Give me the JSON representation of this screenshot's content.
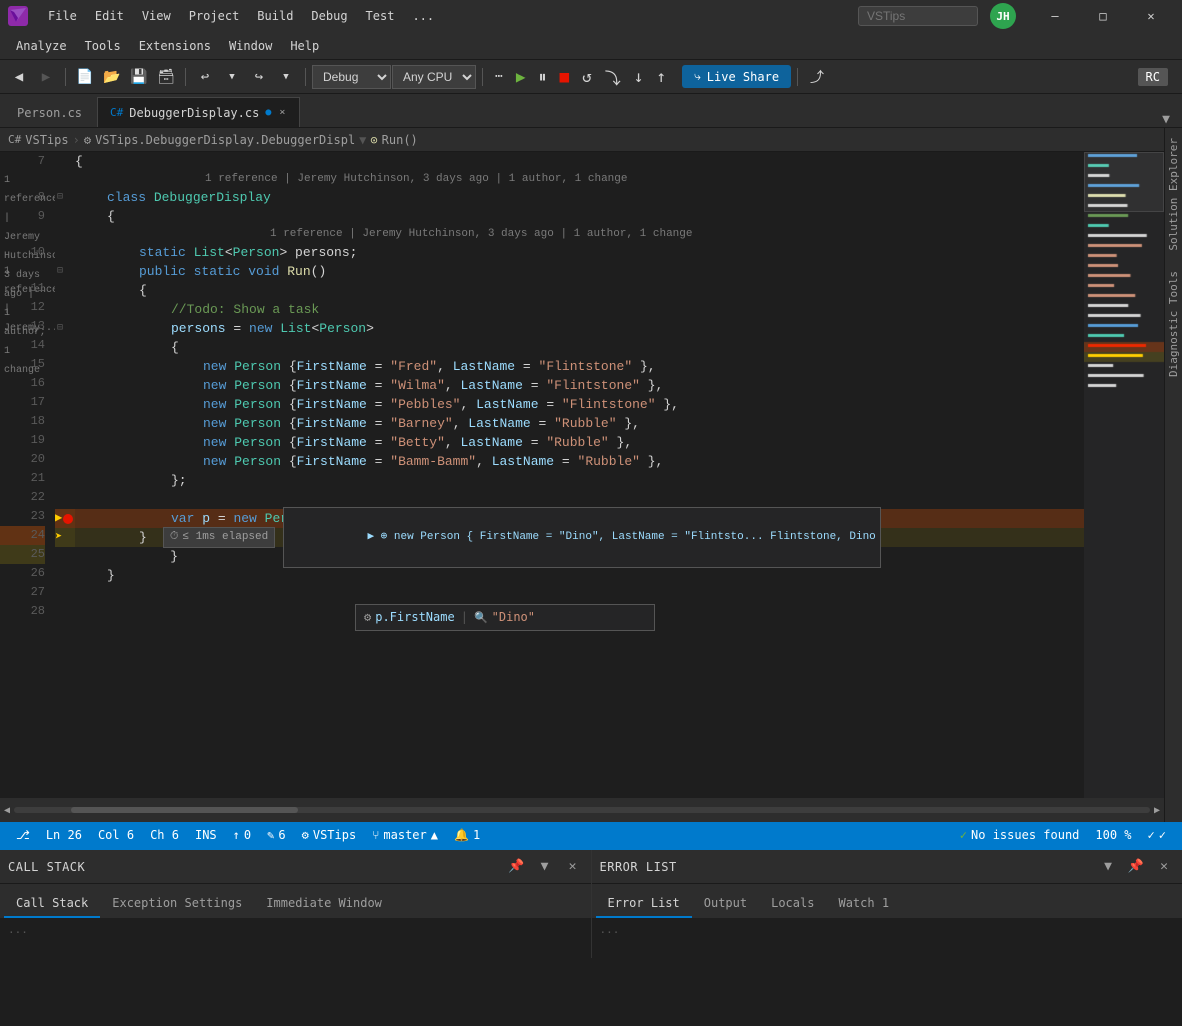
{
  "titleBar": {
    "logoText": "VS",
    "menus": [
      "File",
      "Edit",
      "View",
      "Project",
      "Build",
      "Debug",
      "Test",
      "..."
    ],
    "searchPlaceholder": "VSTips",
    "userInitials": "JH",
    "controls": [
      "—",
      "□",
      "✕"
    ]
  },
  "menuBar": {
    "items": [
      "Analyze",
      "Tools",
      "Extensions",
      "Window",
      "Help"
    ]
  },
  "toolbar": {
    "debugMode": "Debug",
    "platform": "Any CPU",
    "liveShareLabel": "Live Share",
    "rcLabel": "RC"
  },
  "tabs": {
    "inactive": "Person.cs",
    "active": "DebuggerDisplay.cs",
    "closeLabel": "×",
    "modifiedIcon": "●"
  },
  "breadcrumb": {
    "project": "VSTips",
    "class": "VSTips.DebuggerDisplay.DebuggerDispl",
    "method": "Run()"
  },
  "codeLines": [
    {
      "num": "7",
      "indent": 0,
      "tokens": [
        {
          "t": "{",
          "c": "plain"
        }
      ]
    },
    {
      "num": "8",
      "indent": 1,
      "tokens": [
        {
          "t": "class ",
          "c": "kw"
        },
        {
          "t": "DebuggerDisplay",
          "c": "class-name"
        }
      ],
      "codelens": "1 reference | Jeremy Hutchinson, 3 days ago | 1 author, 1 change"
    },
    {
      "num": "9",
      "indent": 1,
      "tokens": [
        {
          "t": "{",
          "c": "plain"
        }
      ]
    },
    {
      "num": "10",
      "indent": 2,
      "tokens": [
        {
          "t": "static ",
          "c": "kw"
        },
        {
          "t": "List",
          "c": "type"
        },
        {
          "t": "<",
          "c": "plain"
        },
        {
          "t": "Person",
          "c": "type"
        },
        {
          "t": "> persons;",
          "c": "plain"
        }
      ],
      "codelens": "1 reference | Jeremy Hutchinson, 3 days ago | 1 author, 1 change"
    },
    {
      "num": "11",
      "indent": 2,
      "tokens": [
        {
          "t": "public ",
          "c": "kw"
        },
        {
          "t": "static ",
          "c": "kw"
        },
        {
          "t": "void ",
          "c": "kw"
        },
        {
          "t": "Run",
          "c": "method"
        },
        {
          "t": "()",
          "c": "plain"
        }
      ]
    },
    {
      "num": "12",
      "indent": 2,
      "tokens": [
        {
          "t": "{",
          "c": "plain"
        }
      ]
    },
    {
      "num": "13",
      "indent": 3,
      "tokens": [
        {
          "t": "//Todo: Show a task",
          "c": "comment"
        }
      ]
    },
    {
      "num": "14",
      "indent": 3,
      "tokens": [
        {
          "t": "persons",
          "c": "prop"
        },
        {
          "t": " = ",
          "c": "plain"
        },
        {
          "t": "new ",
          "c": "kw"
        },
        {
          "t": "List",
          "c": "type"
        },
        {
          "t": "<",
          "c": "plain"
        },
        {
          "t": "Person",
          "c": "type"
        },
        {
          "t": ">",
          "c": "plain"
        }
      ]
    },
    {
      "num": "15",
      "indent": 3,
      "tokens": [
        {
          "t": "{",
          "c": "plain"
        }
      ]
    },
    {
      "num": "16",
      "indent": 4,
      "tokens": [
        {
          "t": "new ",
          "c": "kw"
        },
        {
          "t": "Person",
          "c": "type"
        },
        {
          "t": " {",
          "c": "plain"
        },
        {
          "t": "FirstName",
          "c": "prop"
        },
        {
          "t": " = ",
          "c": "plain"
        },
        {
          "t": "\"Fred\"",
          "c": "str"
        },
        {
          "t": ", ",
          "c": "plain"
        },
        {
          "t": "LastName",
          "c": "prop"
        },
        {
          "t": " = ",
          "c": "plain"
        },
        {
          "t": "\"Flintstone\"",
          "c": "str"
        },
        {
          "t": " },",
          "c": "plain"
        }
      ]
    },
    {
      "num": "17",
      "indent": 4,
      "tokens": [
        {
          "t": "new ",
          "c": "kw"
        },
        {
          "t": "Person",
          "c": "type"
        },
        {
          "t": " {",
          "c": "plain"
        },
        {
          "t": "FirstName",
          "c": "prop"
        },
        {
          "t": " = ",
          "c": "plain"
        },
        {
          "t": "\"Wilma\"",
          "c": "str"
        },
        {
          "t": ", ",
          "c": "plain"
        },
        {
          "t": "LastName",
          "c": "prop"
        },
        {
          "t": " = ",
          "c": "plain"
        },
        {
          "t": "\"Flintstone\"",
          "c": "str"
        },
        {
          "t": " },",
          "c": "plain"
        }
      ]
    },
    {
      "num": "18",
      "indent": 4,
      "tokens": [
        {
          "t": "new ",
          "c": "kw"
        },
        {
          "t": "Person",
          "c": "type"
        },
        {
          "t": " {",
          "c": "plain"
        },
        {
          "t": "FirstName",
          "c": "prop"
        },
        {
          "t": " = ",
          "c": "plain"
        },
        {
          "t": "\"Pebbles\"",
          "c": "str"
        },
        {
          "t": ", ",
          "c": "plain"
        },
        {
          "t": "LastName",
          "c": "prop"
        },
        {
          "t": " = ",
          "c": "plain"
        },
        {
          "t": "\"Flintstone\"",
          "c": "str"
        },
        {
          "t": " },",
          "c": "plain"
        }
      ]
    },
    {
      "num": "19",
      "indent": 4,
      "tokens": [
        {
          "t": "new ",
          "c": "kw"
        },
        {
          "t": "Person",
          "c": "type"
        },
        {
          "t": " {",
          "c": "plain"
        },
        {
          "t": "FirstName",
          "c": "prop"
        },
        {
          "t": " = ",
          "c": "plain"
        },
        {
          "t": "\"Barney\"",
          "c": "str"
        },
        {
          "t": ", ",
          "c": "plain"
        },
        {
          "t": "LastName",
          "c": "prop"
        },
        {
          "t": " = ",
          "c": "plain"
        },
        {
          "t": "\"Rubble\"",
          "c": "str"
        },
        {
          "t": " },",
          "c": "plain"
        }
      ]
    },
    {
      "num": "20",
      "indent": 4,
      "tokens": [
        {
          "t": "new ",
          "c": "kw"
        },
        {
          "t": "Person",
          "c": "type"
        },
        {
          "t": " {",
          "c": "plain"
        },
        {
          "t": "FirstName",
          "c": "prop"
        },
        {
          "t": " = ",
          "c": "plain"
        },
        {
          "t": "\"Betty\"",
          "c": "str"
        },
        {
          "t": ", ",
          "c": "plain"
        },
        {
          "t": "LastName",
          "c": "prop"
        },
        {
          "t": " = ",
          "c": "plain"
        },
        {
          "t": "\"Rubble\"",
          "c": "str"
        },
        {
          "t": " },",
          "c": "plain"
        }
      ]
    },
    {
      "num": "21",
      "indent": 4,
      "tokens": [
        {
          "t": "new ",
          "c": "kw"
        },
        {
          "t": "Person",
          "c": "type"
        },
        {
          "t": " {",
          "c": "plain"
        },
        {
          "t": "FirstName",
          "c": "prop"
        },
        {
          "t": " = ",
          "c": "plain"
        },
        {
          "t": "\"Bamm-Bamm\"",
          "c": "str"
        },
        {
          "t": ", ",
          "c": "plain"
        },
        {
          "t": "LastName",
          "c": "prop"
        },
        {
          "t": " = ",
          "c": "plain"
        },
        {
          "t": "\"Rubble\"",
          "c": "str"
        },
        {
          "t": " },",
          "c": "plain"
        }
      ]
    },
    {
      "num": "22",
      "indent": 3,
      "tokens": [
        {
          "t": "};",
          "c": "plain"
        }
      ]
    },
    {
      "num": "23",
      "indent": 3,
      "tokens": []
    },
    {
      "num": "24",
      "indent": 3,
      "tokens": [
        {
          "t": "var ",
          "c": "kw"
        },
        {
          "t": "p",
          "c": "prop"
        },
        {
          "t": " = ",
          "c": "plain"
        },
        {
          "t": "new ",
          "c": "kw"
        },
        {
          "t": "Person",
          "c": "type"
        },
        {
          "t": " { ",
          "c": "plain"
        },
        {
          "t": "FirstName",
          "c": "prop"
        },
        {
          "t": " = ",
          "c": "plain"
        },
        {
          "t": "\"Dino\"",
          "c": "str"
        },
        {
          "t": ", ",
          "c": "plain"
        },
        {
          "t": "LastName",
          "c": "prop"
        },
        {
          "t": " = ",
          "c": "plain"
        },
        {
          "t": "\"Flintstone\"",
          "c": "str"
        },
        {
          "t": " }",
          "c": "plain"
        }
      ],
      "breakpoint": true,
      "isCurrentLine": true
    },
    {
      "num": "25",
      "indent": 2,
      "tokens": [
        {
          "t": "}",
          "c": "plain"
        }
      ],
      "isNextLine": true
    },
    {
      "num": "26",
      "indent": 2,
      "tokens": [
        {
          "t": "}",
          "c": "plain"
        }
      ]
    },
    {
      "num": "27",
      "indent": 1,
      "tokens": [
        {
          "t": "}",
          "c": "plain"
        }
      ]
    },
    {
      "num": "28",
      "indent": 0,
      "tokens": []
    }
  ],
  "debugTooltip": {
    "icon": "⚙",
    "varName": "p.FirstName",
    "searchIcon": "🔍",
    "value": "\"Dino\""
  },
  "debugWatch": {
    "expandIcon": "▶",
    "watchIcon": "⊕",
    "value": "new Person { FirstName = \"Dino\", LastName = \"Flintsto... Flintstone, Dino"
  },
  "elapsedTime": "≤ 1ms elapsed",
  "scrollBar": {
    "percent": "100 %"
  },
  "statusBar": {
    "lineInfo": "Ln 26",
    "colInfo": "Col 6",
    "chInfo": "Ch 6",
    "insertMode": "INS",
    "errorCount": "0",
    "warningCount": "6",
    "projectName": "VSTips",
    "branchName": "master",
    "notificationCount": "1",
    "noIssuesLabel": "No issues found",
    "upArrow": "↑",
    "downArrow": "↓",
    "pencilIcon": "✎"
  },
  "bottomPanel": {
    "left": {
      "title": "Call Stack",
      "tabs": [
        "Call Stack",
        "Exception Settings",
        "Immediate Window"
      ]
    },
    "right": {
      "title": "Error List",
      "tabs": [
        "Error List",
        "Output",
        "Locals",
        "Watch 1"
      ]
    }
  },
  "rightSidebar": {
    "items": [
      "Solution Explorer",
      "Diagnostic Tools"
    ]
  }
}
